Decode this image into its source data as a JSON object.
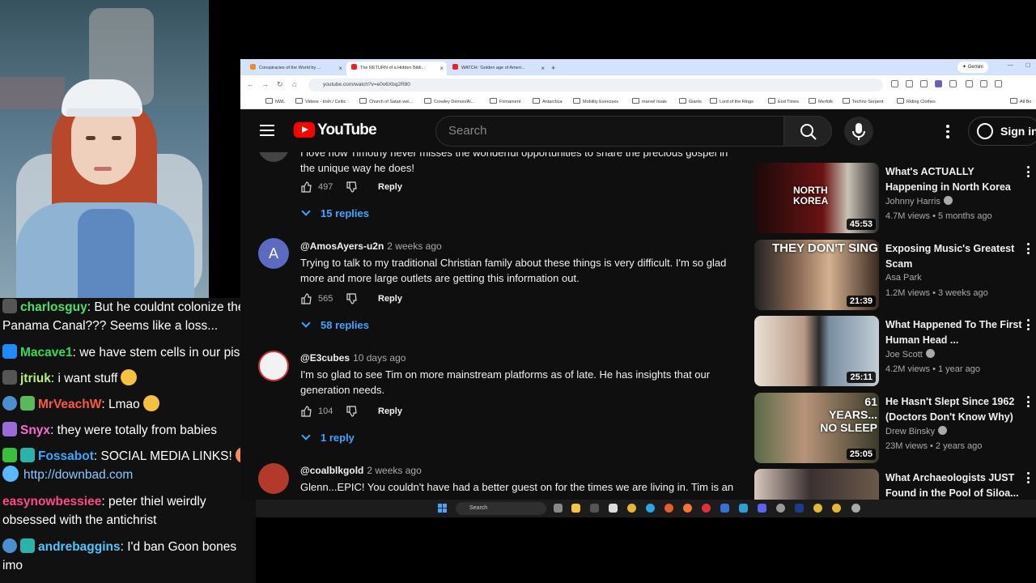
{
  "chat": {
    "messages": [
      {
        "user": "charlosguy",
        "user_color": "#4ee06a",
        "text": ": But he couldnt colonize the Panama Canal??? Seems like a loss..."
      },
      {
        "user": "Macave1",
        "user_color": "#36d95c",
        "text": ": we have stem cells in our piss"
      },
      {
        "user": "jtriuk",
        "user_color": "#b9f07a",
        "text": ": i want stuff"
      },
      {
        "user": "MrVeachW",
        "user_color": "#ff5a3c",
        "text": ": Lmao"
      },
      {
        "user": "Snyx",
        "user_color": "#ff6bd6",
        "text": ": they were totally from babies"
      },
      {
        "user": "Fossabot",
        "user_color": "#3aa7ff",
        "text": ": SOCIAL MEDIA LINKS!",
        "link": "http://downbad.com"
      },
      {
        "user": "easynowbessiee",
        "user_color": "#ff4a86",
        "text": ": peter thiel weirdly obsessed with the antichrist"
      },
      {
        "user": "andrebaggins",
        "user_color": "#4fc6ff",
        "text": ": I'd ban Goon bones imo"
      }
    ]
  },
  "browser": {
    "tabs": [
      {
        "label": "Conspiracies of the World by ..."
      },
      {
        "label": "The RETURN of a Hidden Bibli..."
      },
      {
        "label": "WATCH: 'Golden age of Ameri..."
      }
    ],
    "new_tab": "+",
    "gemini": "Gemini",
    "url": "youtube.com/watch?v=e0v6Xbq2R80",
    "bookmarks": [
      "NWL",
      "Videos - Irish / Celtic",
      "Church of Satan wei...",
      "Crowley Demon/Al...",
      "Firmament",
      "Antarctica",
      "Mobility Exercises",
      "marvel rivals",
      "Giants",
      "Lord of the Rings",
      "End Times",
      "Merfolk",
      "Techno Serpent",
      "Riding Clothes",
      "All Bo"
    ]
  },
  "youtube": {
    "logo_text": "YouTube",
    "search_placeholder": "Search",
    "signin_label": "Sign in"
  },
  "comments": [
    {
      "text": "I love how Timothy never misses the wonderful opportunities to share the precious gospel in the unique way he does!",
      "likes": "497",
      "reply_label": "Reply",
      "replies": "15 replies"
    },
    {
      "author": "@AmosAyers-u2n",
      "time": "2 weeks ago",
      "avatar_letter": "A",
      "text": "Trying to talk to my traditional Christian family about these things is very difficult.  I'm so glad more and more large outlets are getting this information out.",
      "likes": "565",
      "reply_label": "Reply",
      "replies": "58 replies"
    },
    {
      "author": "@E3cubes",
      "time": "10 days ago",
      "text": "I'm so glad to see Tim on more mainstream platforms as of late. He has insights that our generation needs.",
      "likes": "104",
      "reply_label": "Reply",
      "replies": "1 reply"
    },
    {
      "author": "@coalblkgold",
      "time": "2 weeks ago",
      "text": "Glenn...EPIC! You couldn't have had a better guest on for the times we are living in. Tim is an"
    }
  ],
  "recommended": [
    {
      "title": "What's ACTUALLY Happening in North Korea",
      "channel": "Johnny Harris",
      "verified": true,
      "meta": "4.7M views • 5 months ago",
      "duration": "45:53",
      "thumb_text": "NORTH KOREA",
      "thumb_color": "#5a1010"
    },
    {
      "title": "Exposing Music's Greatest Scam",
      "channel": "Asa Park",
      "verified": false,
      "meta": "1.2M views • 3 weeks ago",
      "duration": "21:39",
      "thumb_text": "THEY DON'T SING",
      "thumb_color": "#2a2a2a"
    },
    {
      "title": "What Happened To The First Human Head ...",
      "channel": "Joe Scott",
      "verified": true,
      "meta": "4.2M views • 1 year ago",
      "duration": "25:11",
      "thumb_text": "",
      "thumb_color": "#7a8ea0"
    },
    {
      "title": "He Hasn't Slept Since 1962 (Doctors Don't Know Why)",
      "channel": "Drew Binsky",
      "verified": true,
      "meta": "23M views • 2 years ago",
      "duration": "25:05",
      "thumb_text": "61 YEARS... NO SLEEP",
      "thumb_color": "#4a5a3a"
    },
    {
      "title": "What Archaeologists JUST Found in the Pool of Siloa...",
      "channel": "",
      "verified": false,
      "meta": "",
      "duration": "",
      "thumb_text": "",
      "thumb_color": "#3a3030"
    }
  ],
  "taskbar": {
    "search_label": "Search"
  }
}
